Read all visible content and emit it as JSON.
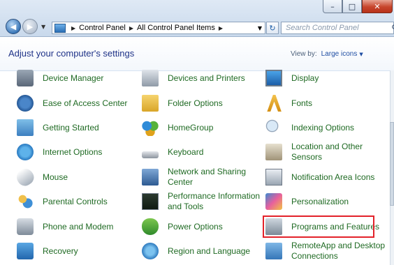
{
  "window": {
    "minimize_glyph": "–",
    "maximize_glyph": "□",
    "close_glyph": "✕"
  },
  "nav": {
    "back_glyph": "◀",
    "forward_glyph": "▶",
    "dropdown_glyph": "▼"
  },
  "address": {
    "crumbs": [
      "Control Panel",
      "All Control Panel Items"
    ],
    "separator": "▶",
    "dropdown_glyph": "▼",
    "refresh_glyph": "↻"
  },
  "search": {
    "placeholder": "Search Control Panel",
    "icon_glyph": "⚲"
  },
  "header": {
    "title": "Adjust your computer's settings",
    "view_by_label": "View by:",
    "view_by_value": "Large icons",
    "view_by_caret": "▼"
  },
  "items": [
    {
      "label": "Device Manager",
      "icon": "device-manager-icon"
    },
    {
      "label": "Devices and Printers",
      "icon": "devices-printers-icon"
    },
    {
      "label": "Display",
      "icon": "display-icon"
    },
    {
      "label": "Ease of Access Center",
      "icon": "ease-of-access-icon"
    },
    {
      "label": "Folder Options",
      "icon": "folder-options-icon"
    },
    {
      "label": "Fonts",
      "icon": "fonts-icon"
    },
    {
      "label": "Getting Started",
      "icon": "getting-started-icon"
    },
    {
      "label": "HomeGroup",
      "icon": "homegroup-icon"
    },
    {
      "label": "Indexing Options",
      "icon": "indexing-options-icon"
    },
    {
      "label": "Internet Options",
      "icon": "internet-options-icon"
    },
    {
      "label": "Keyboard",
      "icon": "keyboard-icon"
    },
    {
      "label": "Location and Other Sensors",
      "icon": "location-sensors-icon"
    },
    {
      "label": "Mouse",
      "icon": "mouse-icon"
    },
    {
      "label": "Network and Sharing Center",
      "icon": "network-sharing-icon"
    },
    {
      "label": "Notification Area Icons",
      "icon": "notification-area-icon"
    },
    {
      "label": "Parental Controls",
      "icon": "parental-controls-icon"
    },
    {
      "label": "Performance Information and Tools",
      "icon": "performance-icon"
    },
    {
      "label": "Personalization",
      "icon": "personalization-icon"
    },
    {
      "label": "Phone and Modem",
      "icon": "phone-modem-icon"
    },
    {
      "label": "Power Options",
      "icon": "power-options-icon"
    },
    {
      "label": "Programs and Features",
      "icon": "programs-features-icon"
    },
    {
      "label": "Recovery",
      "icon": "recovery-icon"
    },
    {
      "label": "Region and Language",
      "icon": "region-language-icon"
    },
    {
      "label": "RemoteApp and Desktop Connections",
      "icon": "remoteapp-icon"
    }
  ],
  "highlighted_item": "Programs and Features",
  "colors": {
    "link_green": "#1f6a23",
    "title_blue": "#1e3287",
    "highlight_red": "#e3222a"
  }
}
